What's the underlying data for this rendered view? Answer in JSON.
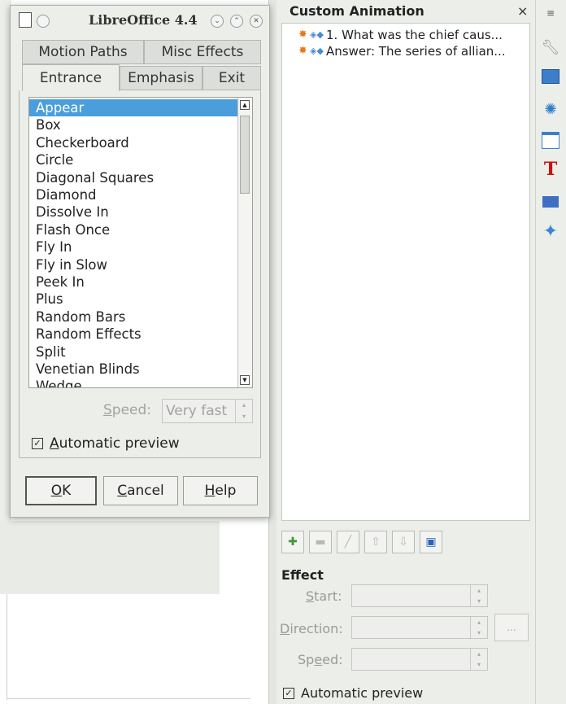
{
  "dialog": {
    "title": "LibreOffice 4.4",
    "tabs_row1": [
      "Motion Paths",
      "Misc Effects"
    ],
    "tabs_row2": [
      "Entrance",
      "Emphasis",
      "Exit"
    ],
    "active_tab": "Entrance",
    "effects": [
      "Appear",
      "Box",
      "Checkerboard",
      "Circle",
      "Diagonal Squares",
      "Diamond",
      "Dissolve In",
      "Flash Once",
      "Fly In",
      "Fly in Slow",
      "Peek In",
      "Plus",
      "Random Bars",
      "Random Effects",
      "Split",
      "Venetian Blinds",
      "Wedge"
    ],
    "selected_effect": "Appear",
    "speed_label": "Speed:",
    "speed_value": "Very fast",
    "automatic_preview_label": "Automatic preview",
    "automatic_preview_checked": true,
    "ok_label": "OK",
    "cancel_label": "Cancel",
    "help_label": "Help"
  },
  "panel": {
    "title": "Custom Animation",
    "close": "×",
    "items": [
      "1. What was the chief caus...",
      "Answer: The series of allian..."
    ],
    "effect_heading": "Effect",
    "start_label": "Start:",
    "direction_label": "Direction:",
    "speed_label": "Speed:",
    "dots_label": "...",
    "automatic_preview_label": "Automatic preview"
  },
  "sidebar": {
    "icons": [
      "more-icon",
      "wrench-icon",
      "slide-layout-icon",
      "custom-animation-icon",
      "chart-icon",
      "fontwork-icon",
      "gallery-icon",
      "navigator-icon"
    ]
  },
  "colors": {
    "selection": "#4a9edb",
    "panel_bg": "#eceeea"
  }
}
